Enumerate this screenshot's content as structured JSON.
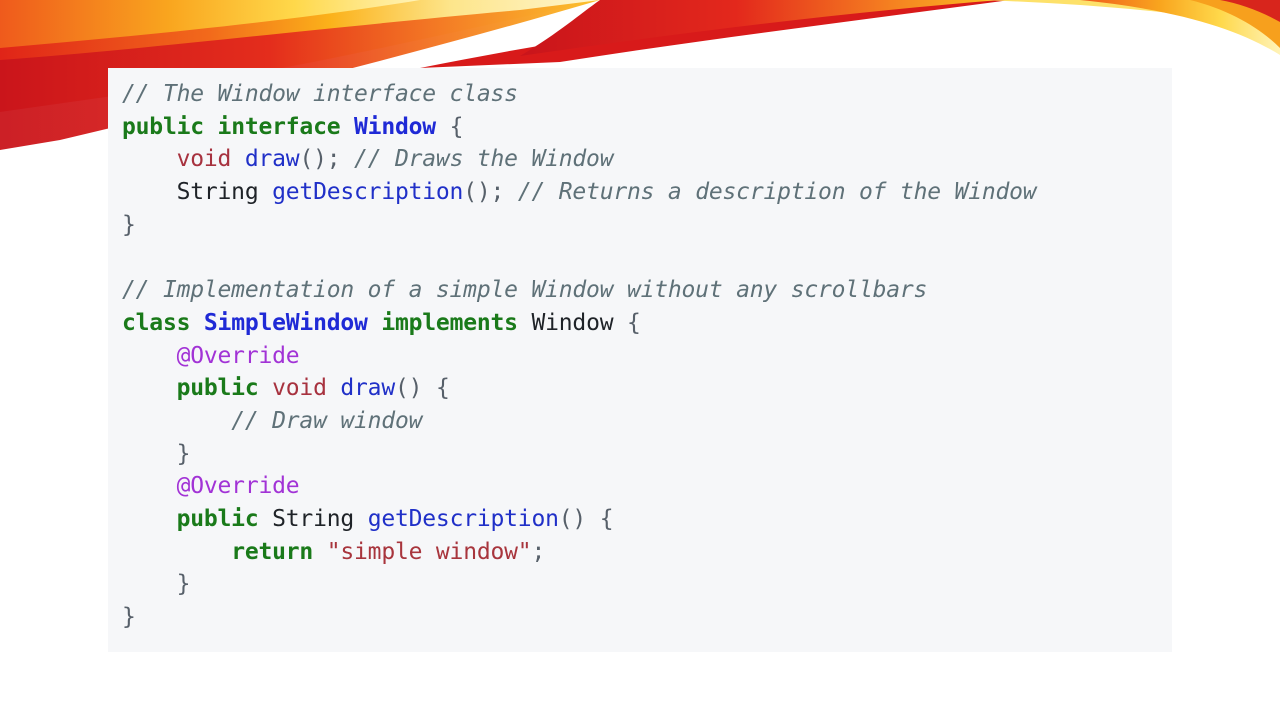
{
  "code": {
    "line1": {
      "comment": "// The Window interface class"
    },
    "line2": {
      "kw_public": "public",
      "kw_interface": "interface",
      "name": "Window",
      "brace": "{"
    },
    "line3": {
      "indent": "    ",
      "type": "void",
      "func": "draw",
      "punct": "();",
      "comment": "// Draws the Window"
    },
    "line4": {
      "indent": "    ",
      "type": "String",
      "func": "getDescription",
      "punct": "();",
      "comment": "// Returns a description of the Window"
    },
    "line5": {
      "brace": "}"
    },
    "line6": {},
    "line7": {
      "comment": "// Implementation of a simple Window without any scrollbars"
    },
    "line8": {
      "kw_class": "class",
      "name": "SimpleWindow",
      "kw_implements": "implements",
      "iface": "Window",
      "brace": "{"
    },
    "line9": {
      "indent": "    ",
      "annotation": "@Override"
    },
    "line10": {
      "indent": "    ",
      "kw_public": "public",
      "type": "void",
      "func": "draw",
      "punct": "()",
      "brace": "{"
    },
    "line11": {
      "indent": "        ",
      "comment": "// Draw window"
    },
    "line12": {
      "indent": "    ",
      "brace": "}"
    },
    "line13": {
      "indent": "    ",
      "annotation": "@Override"
    },
    "line14": {
      "indent": "    ",
      "kw_public": "public",
      "type": "String",
      "func": "getDescription",
      "punct": "()",
      "brace": "{"
    },
    "line15": {
      "indent": "        ",
      "kw_return": "return",
      "string": "\"simple window\"",
      "semi": ";"
    },
    "line16": {
      "indent": "    ",
      "brace": "}"
    },
    "line17": {
      "brace": "}"
    }
  },
  "colors": {
    "background": "#ffffff",
    "panel": "#f6f7f9",
    "comment": "#5f7178",
    "keyword": "#1a7a1a",
    "type_name": "#1f2ad6",
    "void": "#a7323f",
    "annotation": "#a233d6",
    "string": "#a8353d",
    "function": "#2030c8",
    "swoosh_red": "#e0201a",
    "swoosh_orange": "#f7941d",
    "swoosh_yellow": "#fcd116"
  }
}
